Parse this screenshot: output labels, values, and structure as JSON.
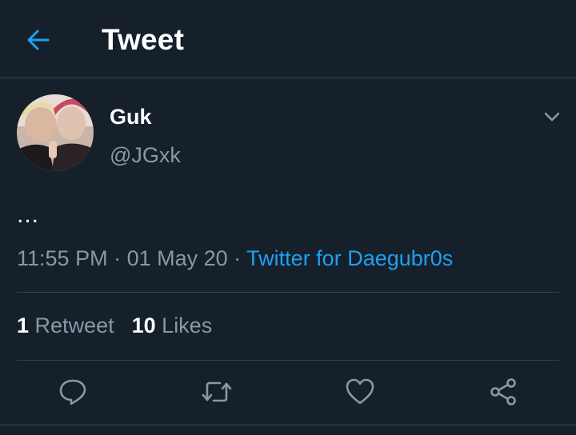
{
  "header": {
    "title": "Tweet",
    "back_icon": "arrow-left-icon"
  },
  "tweet": {
    "display_name": "Guk",
    "handle": "@JGxk",
    "text": "...",
    "time": "11:55 PM",
    "separator": " · ",
    "date": "01 May 20",
    "source": "Twitter for Daegubr0s"
  },
  "stats": {
    "retweet_count": "1",
    "retweet_label": "Retweet",
    "like_count": "10",
    "like_label": "Likes"
  },
  "actions": [
    {
      "icon": "reply-icon"
    },
    {
      "icon": "retweet-icon"
    },
    {
      "icon": "like-icon"
    },
    {
      "icon": "share-icon"
    }
  ],
  "colors": {
    "background": "#15202b",
    "accent": "#1da1f2",
    "muted": "#8899a6",
    "divider": "#38444d"
  }
}
